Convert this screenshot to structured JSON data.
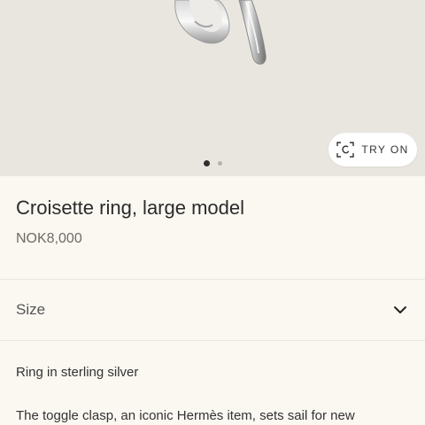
{
  "hero": {
    "image_alt": "Silver toggle ring",
    "try_on_label": "TRY ON",
    "carousel": {
      "count": 2,
      "active": 1
    }
  },
  "product": {
    "title": "Croisette ring, large model",
    "price": "NOK8,000"
  },
  "size": {
    "label": "Size"
  },
  "description": {
    "short": "Ring in sterling silver",
    "long": "The toggle clasp, an iconic Hermès item, sets sail for new"
  },
  "colors": {
    "background": "#fbf8f2",
    "hero_background": "#e9e6e0",
    "text": "#2b2b2b",
    "muted": "#6e6a66"
  },
  "icons": {
    "try_on": "ar-scan-icon",
    "size_toggle": "chevron-down-icon"
  }
}
